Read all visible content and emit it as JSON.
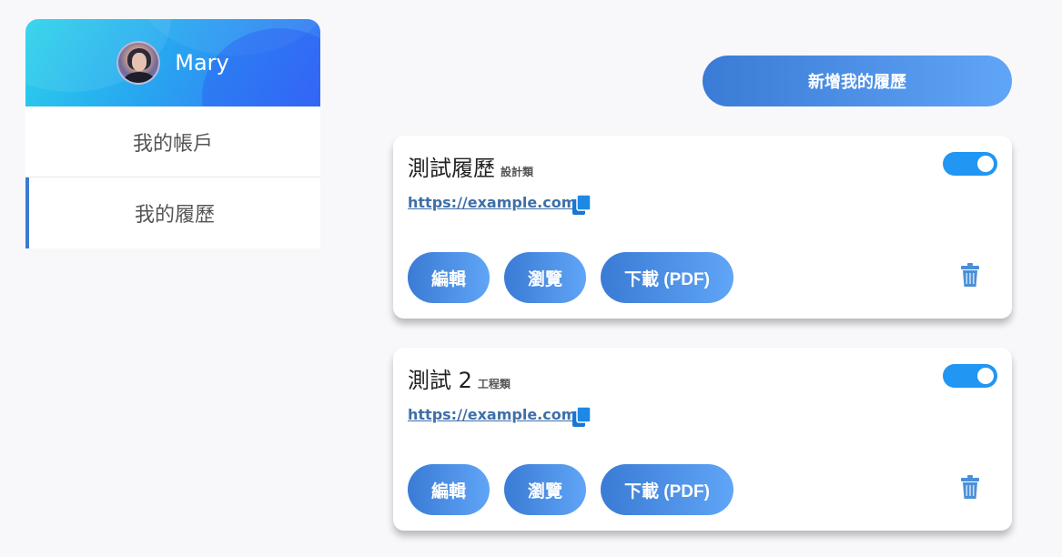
{
  "sidebar": {
    "user": {
      "name": "Mary",
      "avatar_icon": "user-avatar"
    },
    "items": [
      {
        "label": "我的帳戶",
        "active": false
      },
      {
        "label": "我的履歷",
        "active": true
      }
    ]
  },
  "main": {
    "add_button_label": "新增我的履歷",
    "resumes": [
      {
        "title": "測試履歷",
        "category": "設計類",
        "url": "https://example.com",
        "enabled": true,
        "buttons": {
          "edit": "編輯",
          "view": "瀏覽",
          "download": "下載 (PDF)"
        }
      },
      {
        "title": "測試 2",
        "category": "工程類",
        "url": "https://example.com",
        "enabled": true,
        "buttons": {
          "edit": "編輯",
          "view": "瀏覽",
          "download": "下載 (PDF)"
        }
      }
    ]
  },
  "colors": {
    "accent": "#3a7bd5",
    "toggle_on": "#2196f3",
    "link": "#3f6fa8",
    "background": "#f8f8fb"
  }
}
